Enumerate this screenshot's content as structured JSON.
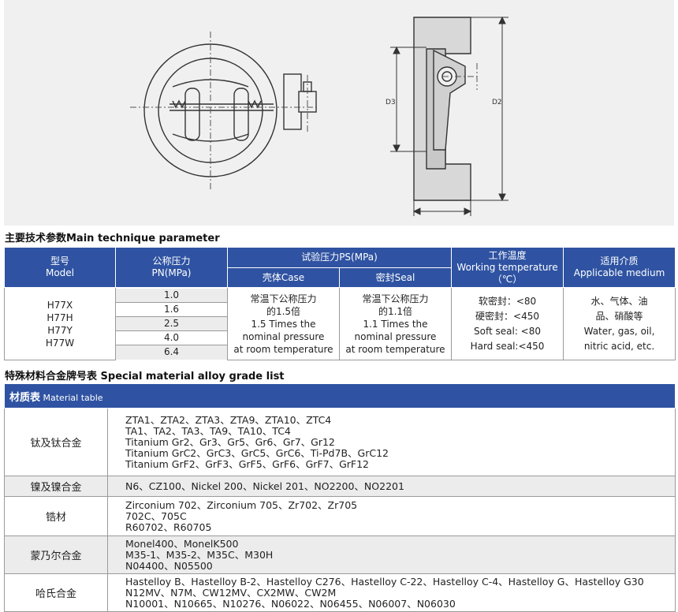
{
  "drawing": {
    "label_d3": "D3",
    "label_d2": "D2"
  },
  "section1_title": "主要技术参数Main technique parameter",
  "param_table": {
    "h_model": [
      "型号",
      "Model"
    ],
    "h_pn": [
      "公称压力",
      "PN(MPa)"
    ],
    "h_test": "试验压力PS(MPa)",
    "h_case": "壳体Case",
    "h_seal": "密封Seal",
    "h_temp": [
      "工作温度",
      "Working temperature",
      "（℃）"
    ],
    "h_medium": [
      "适用介质",
      "Applicable medium"
    ],
    "models": [
      "H77X",
      "H77H",
      "H77Y",
      "H77W"
    ],
    "pn_values": [
      "1.0",
      "1.6",
      "2.5",
      "4.0",
      "6.4"
    ],
    "case_text": [
      "常温下公称压力",
      "的1.5倍",
      "1.5 Times the",
      "nominal pressure",
      "at room temperature"
    ],
    "seal_text": [
      "常温下公称压力",
      "的1.1倍",
      "1.1 Times the",
      "nominal pressure",
      "at room temperature"
    ],
    "temp_text": [
      "软密封：<80",
      "硬密封：<450",
      "Soft seal: <80",
      "Hard seal:<450"
    ],
    "medium_text": [
      "水、气体、油",
      "品、硝酸等",
      "Water, gas, oil,",
      "nitric acid, etc."
    ]
  },
  "section2_title": "特殊材料合金牌号表 Special material alloy grade list",
  "material_table": {
    "header_cn": "材质表",
    "header_en": "Material table",
    "rows": [
      {
        "category": "钛及钛合金",
        "lines": [
          "ZTA1、ZTA2、ZTA3、ZTA9、ZTA10、ZTC4",
          "TA1、TA2、TA3、TA9、TA10、TC4",
          "Titanium Gr2、Gr3、Gr5、Gr6、Gr7、Gr12",
          "Titanium GrC2、GrC3、GrC5、GrC6、Ti-Pd7B、GrC12",
          "Titanium GrF2、GrF3、GrF5、GrF6、GrF7、GrF12"
        ]
      },
      {
        "category": "镍及镍合金",
        "lines": [
          "N6、CZ100、Nickel 200、Nickel 201、NO2200、NO2201"
        ]
      },
      {
        "category": "锆材",
        "lines": [
          "Zirconium 702、Zirconium 705、Zr702、Zr705",
          "702C、705C",
          "R60702、R60705"
        ]
      },
      {
        "category": "蒙乃尔合金",
        "lines": [
          "Monel400、MonelK500",
          "M35-1、M35-2、M35C、M30H",
          "N04400、N05500"
        ]
      },
      {
        "category": "哈氏合金",
        "lines": [
          "Hastelloy B、Hastelloy B-2、Hastelloy C276、Hastelloy C-22、Hastelloy C-4、Hastelloy G、Hastelloy G30",
          "N12MV、N7M、CW12MV、CX2MW、CW2M",
          "N10001、N10665、N10276、N06022、N06455、N06007、N06030"
        ]
      }
    ]
  }
}
